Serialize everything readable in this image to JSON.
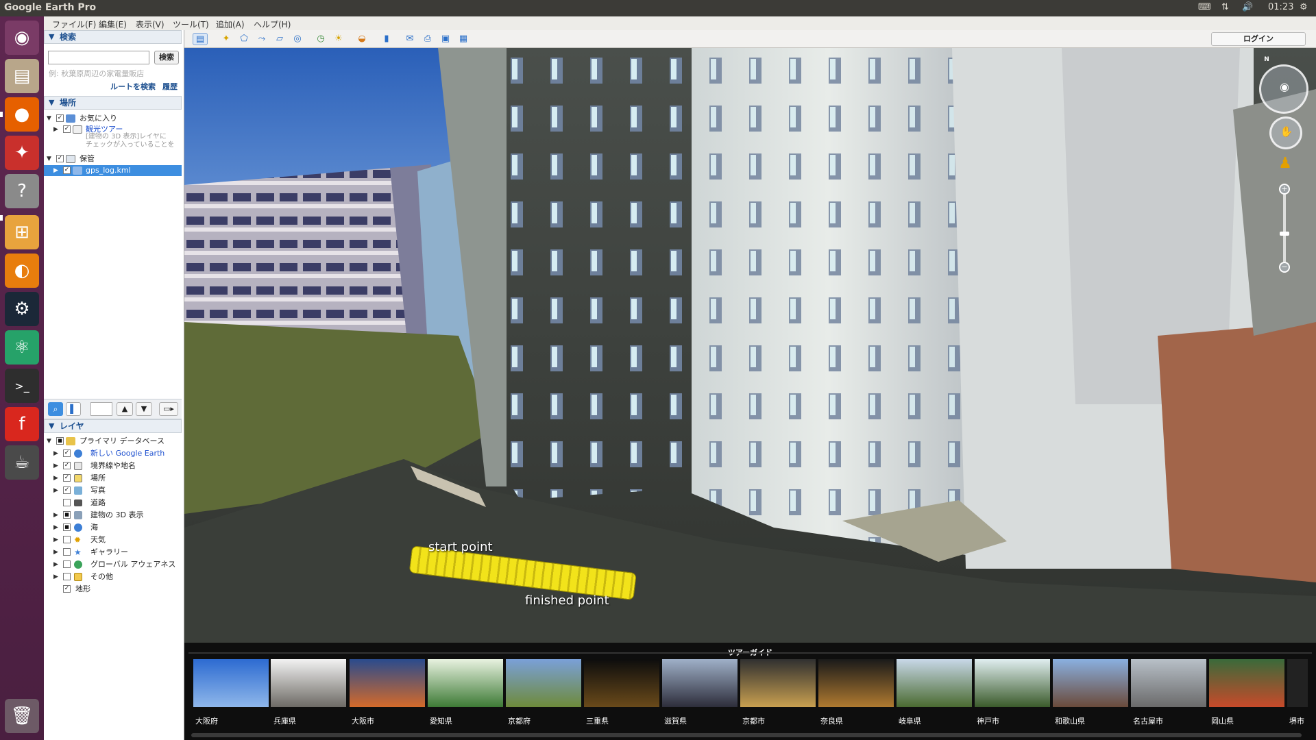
{
  "app": {
    "title": "Google Earth Pro",
    "clock": "01:23"
  },
  "menu": {
    "items": [
      "ファイル(F)",
      "編集(E)",
      "表示(V)",
      "ツール(T)",
      "追加(A)",
      "ヘルプ(H)"
    ]
  },
  "search": {
    "header": "検索",
    "input_value": "",
    "button_label": "検索",
    "hint": "例: 秋葉原周辺の家電量販店",
    "route_link": "ルートを検索",
    "history_link": "履歴"
  },
  "places": {
    "header": "場所",
    "favorites": "お気に入り",
    "sightseeing": "観光ツアー",
    "sightseeing_note_1": "[建物の 3D 表示]レイヤに",
    "sightseeing_note_2": "チェックが入っていることを",
    "saved": "保管",
    "gps_file": "gps_log.kml"
  },
  "layers": {
    "header": "レイヤ",
    "primary_db": "プライマリ データベース",
    "items": [
      {
        "label": "新しい Google Earth",
        "checked": true
      },
      {
        "label": "境界線や地名",
        "checked": true
      },
      {
        "label": "場所",
        "checked": true
      },
      {
        "label": "写真",
        "checked": true
      },
      {
        "label": "道路",
        "checked": false
      },
      {
        "label": "建物の 3D 表示",
        "checked": "partial"
      },
      {
        "label": "海",
        "checked": "partial"
      },
      {
        "label": "天気",
        "checked": false
      },
      {
        "label": "ギャラリー",
        "checked": false
      },
      {
        "label": "グローバル アウェアネス",
        "checked": false
      },
      {
        "label": "その他",
        "checked": false
      },
      {
        "label": "地形",
        "checked": true
      }
    ]
  },
  "toolbar": {
    "login_label": "ログイン"
  },
  "view": {
    "start_label": "start point",
    "finish_label": "finished point",
    "compass_letter": "N"
  },
  "tour": {
    "title": "ツアーガイド",
    "items": [
      "大阪府",
      "兵庫県",
      "大阪市",
      "愛知県",
      "京都府",
      "三重県",
      "滋賀県",
      "京都市",
      "奈良県",
      "岐阜県",
      "神戸市",
      "和歌山県",
      "名古屋市",
      "岡山県",
      "堺市"
    ]
  },
  "colors": {
    "accent": "#2a6fc9",
    "selection": "#3d8ee0",
    "track": "#f2e31a",
    "launcher": "#5e2750"
  }
}
